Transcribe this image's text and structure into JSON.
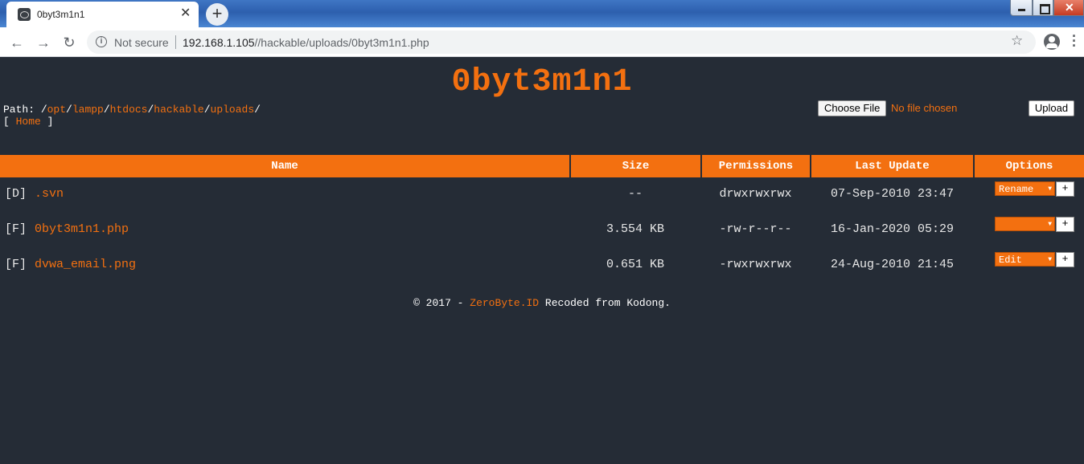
{
  "browser": {
    "tab_title": "0byt3m1n1",
    "tab_close": "✕",
    "new_tab": "+",
    "security_label": "Not secure",
    "url_host": "192.168.1.105",
    "url_path": "//hackable/uploads/0byt3m1n1.php",
    "icons": {
      "back": "back-arrow-icon",
      "forward": "forward-arrow-icon",
      "reload": "reload-icon",
      "info": "info-icon",
      "bookmark": "star-icon",
      "profile": "profile-icon",
      "menu": "menu-icon"
    }
  },
  "page": {
    "logo": "0byt3m1n1",
    "path_label": "Path: ",
    "path_segments": [
      "opt",
      "lampp",
      "htdocs",
      "hackable",
      "uploads"
    ],
    "home_open": "[ ",
    "home_label": "Home",
    "home_close": " ]",
    "upload": {
      "choose_file_label": "Choose File",
      "no_file_text": "No file chosen",
      "upload_label": "Upload"
    },
    "table": {
      "headers": [
        "Name",
        "Size",
        "Permissions",
        "Last Update",
        "Options"
      ],
      "rows": [
        {
          "type": "[D]",
          "name": ".svn",
          "size": "--",
          "perms": "drwxrwxrwx",
          "updated": "07-Sep-2010 23:47",
          "option": "Rename"
        },
        {
          "type": "[F]",
          "name": "0byt3m1n1.php",
          "size": "3.554 KB",
          "perms": "-rw-r--r--",
          "updated": "16-Jan-2020 05:29",
          "option": ""
        },
        {
          "type": "[F]",
          "name": "dvwa_email.png",
          "size": "0.651 KB",
          "perms": "-rwxrwxrwx",
          "updated": "24-Aug-2010 21:45",
          "option": "Edit"
        }
      ],
      "plus_label": "+"
    },
    "footer": {
      "prefix": "© 2017 - ",
      "link": "ZeroByte.ID",
      "suffix": " Recoded from Kodong."
    },
    "colors": {
      "background": "#252c36",
      "accent": "#f37010",
      "permission_green": "#1be01b"
    }
  }
}
